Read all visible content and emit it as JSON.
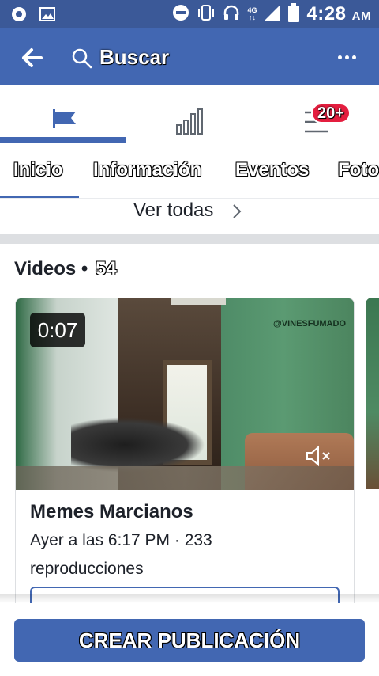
{
  "status_bar": {
    "time": "4:28",
    "ampm": "AM",
    "network_top": "4G",
    "network_bottom": "↑↓",
    "icons": [
      "record-icon",
      "image-icon",
      "do-not-disturb-icon",
      "vibrate-icon",
      "headset-icon",
      "signal-icon",
      "battery-icon"
    ]
  },
  "topbar": {
    "search_placeholder": "Buscar",
    "icons": [
      "back-arrow-icon",
      "search-icon",
      "more-options-icon"
    ]
  },
  "icon_tabs": {
    "items": [
      {
        "name": "page-flag-icon",
        "active": true
      },
      {
        "name": "insights-icon",
        "active": false
      },
      {
        "name": "menu-icon",
        "active": false
      }
    ],
    "notification_badge": "20+"
  },
  "page_tabs": {
    "items": [
      {
        "label": "Inicio",
        "active": true
      },
      {
        "label": "Información"
      },
      {
        "label": "Eventos"
      },
      {
        "label": "Foto"
      }
    ]
  },
  "see_all": {
    "label": "Ver todas"
  },
  "videos": {
    "title": "Videos •",
    "count": "54",
    "card": {
      "duration": "0:07",
      "watermark": "@VINESFUMADO",
      "title": "Memes Marcianos",
      "meta": "Ayer a las 6:17 PM · 233 reproducciones"
    }
  },
  "bottom": {
    "create_post": "CREAR PUBLICACIÓN"
  },
  "colors": {
    "brand": "#4267b2",
    "status_bar": "#3b5998",
    "badge": "#e41e3f",
    "divider": "#dddfe2"
  }
}
